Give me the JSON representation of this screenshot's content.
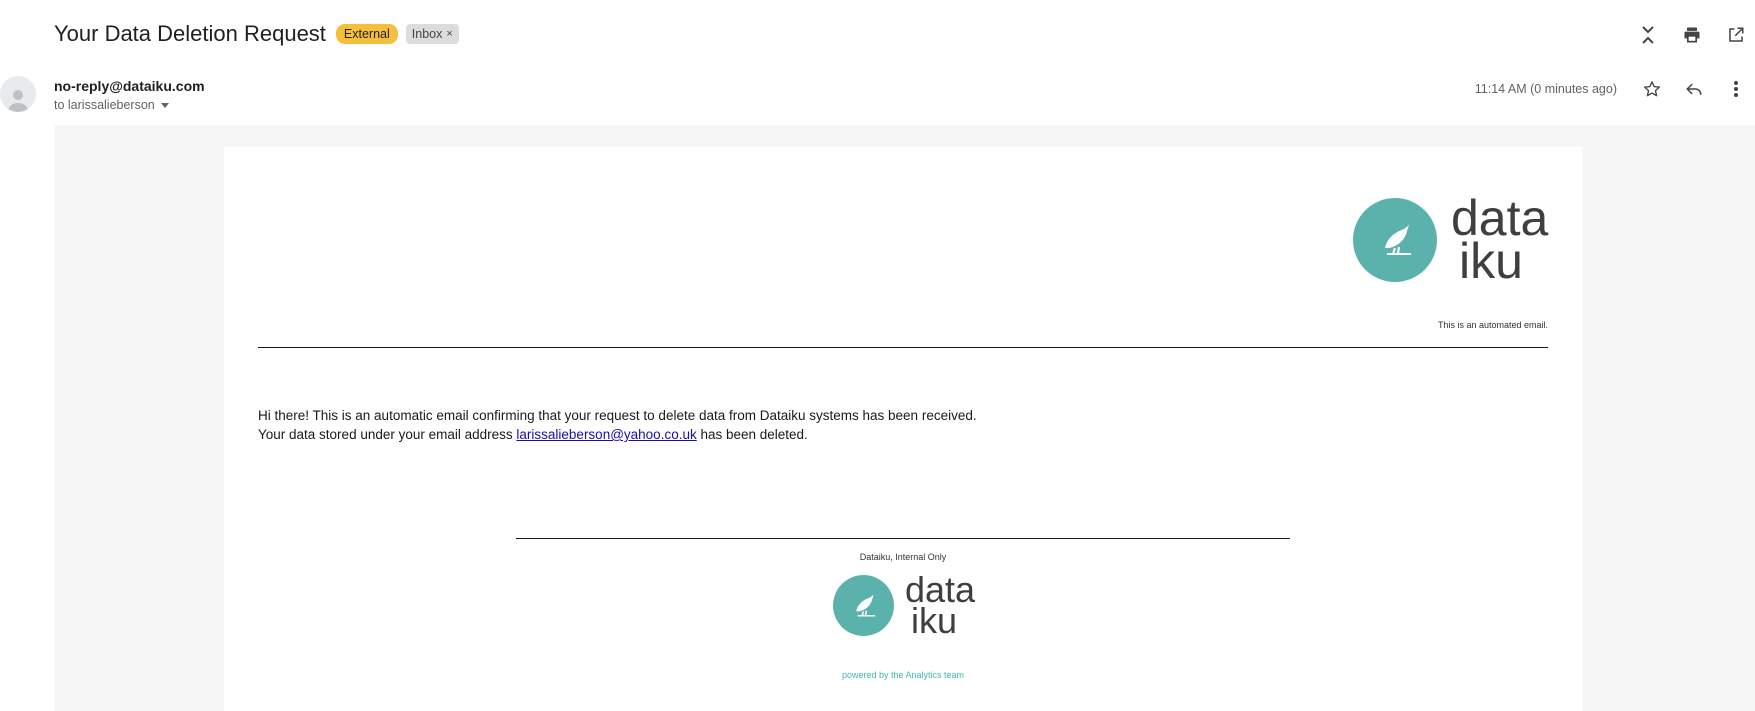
{
  "email": {
    "subject": "Your Data Deletion Request",
    "labels": {
      "external": "External",
      "inbox": "Inbox",
      "remove_symbol": "×"
    },
    "sender": "no-reply@dataiku.com",
    "recipient": "to larissalieberson",
    "timestamp": "11:14 AM (0 minutes ago)"
  },
  "message": {
    "logo_text_line1": "data",
    "logo_text_line2": "iku",
    "automated_note": "This is an automated email.",
    "line1": "Hi there! This is an automatic email confirming that your request to delete data from Dataiku systems has been received.",
    "line2_prefix": "Your data stored under your email address ",
    "email_link": "larissalieberson@yahoo.co.uk",
    "line2_suffix": " has been deleted.",
    "footer_org": "Dataiku, Internal Only",
    "powered_by": "powered by the Analytics team"
  },
  "icons": {
    "expand": "expand-collapse-icon",
    "print": "print-icon",
    "open": "open-in-new-window-icon",
    "star": "star-icon",
    "reply": "reply-icon",
    "more": "more-vertical-icon",
    "avatar": "person-avatar-icon",
    "bird": "dataiku-bird-icon"
  },
  "colors": {
    "external_badge": "#f6bf3b",
    "inbox_badge": "#dcdcdc",
    "logo_teal": "#5bb2ad",
    "link": "#1a0dab",
    "powered_text": "#3db9b2"
  }
}
